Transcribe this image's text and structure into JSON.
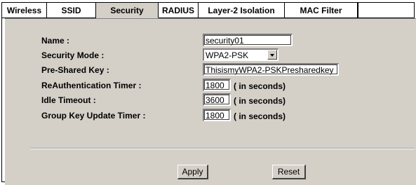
{
  "tabs": [
    {
      "label": "Wireless",
      "active": false
    },
    {
      "label": "SSID",
      "active": false
    },
    {
      "label": "Security",
      "active": true
    },
    {
      "label": "RADIUS",
      "active": false
    },
    {
      "label": "Layer-2 Isolation",
      "active": false
    },
    {
      "label": "MAC Filter",
      "active": false
    }
  ],
  "form": {
    "name": {
      "label": "Name :",
      "value": "security01"
    },
    "security_mode": {
      "label": "Security Mode :",
      "value": "WPA2-PSK"
    },
    "psk": {
      "label": "Pre-Shared Key :",
      "value": "ThisismyWPA2-PSKPresharedkey"
    },
    "reauth": {
      "label": "ReAuthentication Timer :",
      "value": "1800",
      "unit": "( in seconds)"
    },
    "idle": {
      "label": "Idle Timeout :",
      "value": "3600",
      "unit": "( in seconds)"
    },
    "group_key": {
      "label": "Group Key Update Timer :",
      "value": "1800",
      "unit": "( in seconds)"
    }
  },
  "buttons": {
    "apply": "Apply",
    "reset": "Reset"
  },
  "colors": {
    "panel_bg": "#d4d0c8",
    "active_tab_bg": "#d4d0c8"
  },
  "icons": {
    "dropdown": "chevron-down-icon"
  }
}
